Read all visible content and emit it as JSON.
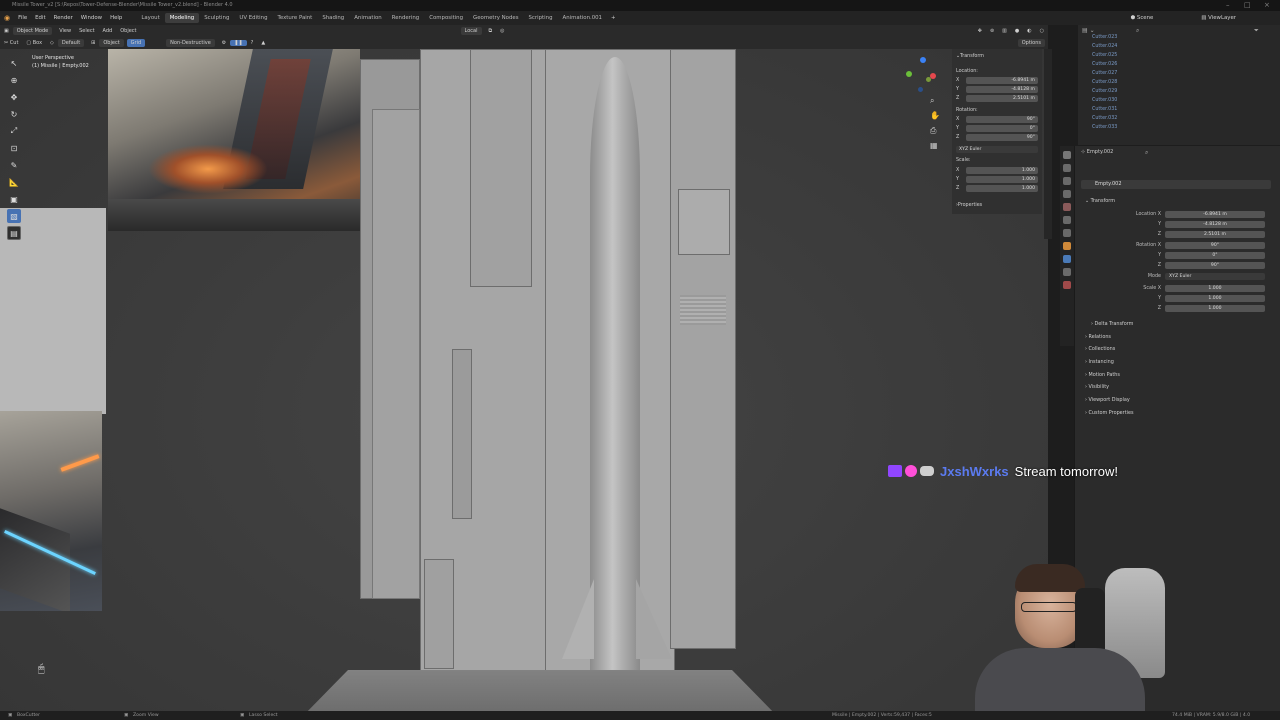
{
  "titlebar": {
    "title": "Missile Tower_v2 [S:\\Repos\\Tower-Defense-Blender\\Missile Tower_v2.blend] - Blender 4.0"
  },
  "menu": {
    "items": [
      "File",
      "Edit",
      "Render",
      "Window",
      "Help"
    ],
    "workspaces": [
      "Layout",
      "Modeling",
      "Sculpting",
      "UV Editing",
      "Texture Paint",
      "Shading",
      "Animation",
      "Rendering",
      "Compositing",
      "Geometry Nodes",
      "Scripting",
      "Animation.001"
    ],
    "active_workspace": "Modeling",
    "scene_label": "Scene",
    "viewlayer_label": "ViewLayer"
  },
  "viewport_header": {
    "mode": "Object Mode",
    "view": "View",
    "select": "Select",
    "add": "Add",
    "object": "Object",
    "transform_orientation": "Default",
    "object_label": "Object",
    "snap": "Grid",
    "boolean_mode": "Non-Destructive",
    "pivot": "Local",
    "options": "Options",
    "tool_cut": "Cut",
    "tool_box": "Box"
  },
  "viewport_info": {
    "perspective": "User Perspective",
    "collection": "(1) Missile | Empty.002"
  },
  "npanel": {
    "section": "Transform",
    "location_label": "Location:",
    "location": {
      "x": "-6.8941 m",
      "y": "-4.8128 m",
      "z": "2.5101 m"
    },
    "rotation_label": "Rotation:",
    "rotation": {
      "x": "90°",
      "y": "0°",
      "z": "90°"
    },
    "rotation_mode": "XYZ Euler",
    "scale_label": "Scale:",
    "scale": {
      "x": "1.000",
      "y": "1.000",
      "z": "1.000"
    },
    "properties": "Properties",
    "axes": [
      "X",
      "Y",
      "Z"
    ]
  },
  "outliner": {
    "items": [
      "Cutter.023",
      "Cutter.024",
      "Cutter.025",
      "Cutter.026",
      "Cutter.027",
      "Cutter.028",
      "Cutter.029",
      "Cutter.030",
      "Cutter.031",
      "Cutter.032",
      "Cutter.033"
    ]
  },
  "properties": {
    "object_name": "Empty.002",
    "object_field": "Empty.002",
    "transform": "Transform",
    "location_label": "Location X",
    "location": [
      "-6.8941 m",
      "-4.8128 m",
      "2.5101 m"
    ],
    "rotation_label": "Rotation X",
    "rotation": [
      "90°",
      "0°",
      "90°"
    ],
    "mode_label": "Mode",
    "mode": "XYZ Euler",
    "scale_label": "Scale X",
    "scale": [
      "1.000",
      "1.000",
      "1.000"
    ],
    "y_label": "Y",
    "z_label": "Z",
    "sections": [
      "Delta Transform",
      "Relations",
      "Collections",
      "Instancing",
      "Motion Paths",
      "Visibility",
      "Viewport Display",
      "Custom Properties"
    ]
  },
  "statusbar": {
    "left1": "BoxCutter",
    "left2": "Zoom View",
    "left3": "Lasso Select",
    "right": "Missile | Empty.002 | Verts:59,437 | Faces:5",
    "right2": "74.4 MiB | VRAM: 5.9/8.0 GiB | 4.0"
  },
  "chat": {
    "username": "JxshWxrks",
    "message": "Stream tomorrow!"
  },
  "colors": {
    "accent": "#4772b3",
    "twitch": "#9146ff",
    "chat_name": "#5b7bf0"
  }
}
